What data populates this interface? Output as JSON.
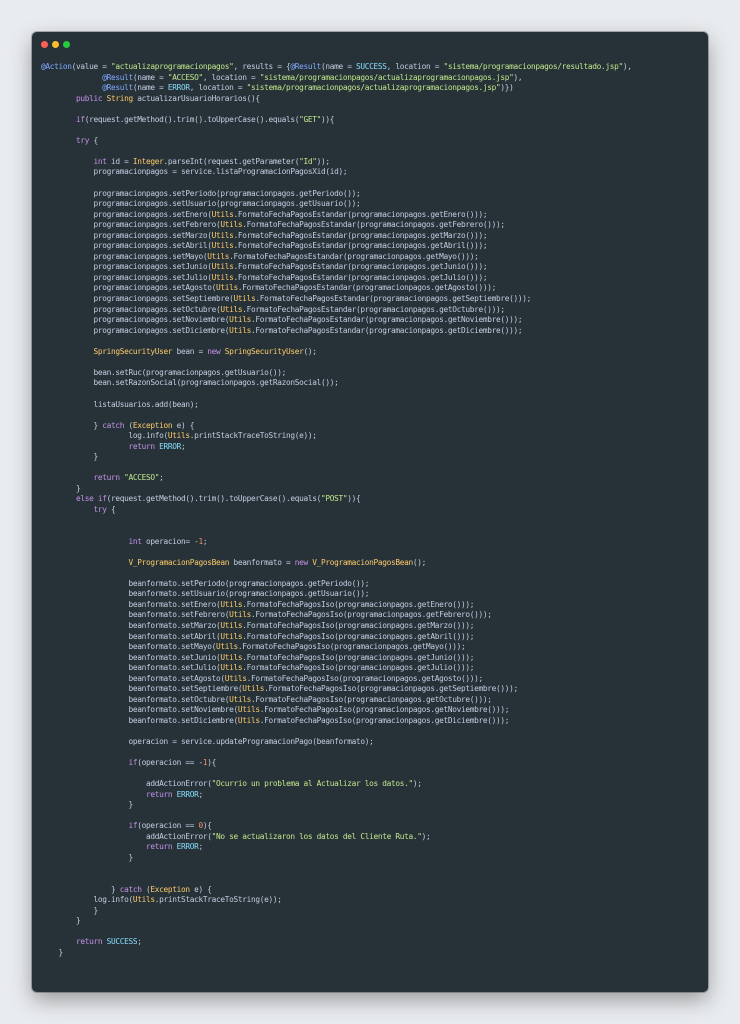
{
  "window": {
    "title_dots": [
      "close",
      "minimize",
      "maximize"
    ]
  },
  "colors": {
    "background": "#e9ecef",
    "editor": "#263238",
    "default": "#c3cee3",
    "keyword": "#c792ea",
    "annotation": "#82aaff",
    "string": "#c3e88d",
    "number": "#f78c6c",
    "type": "#ffcb6b",
    "punct": "#89ddff"
  },
  "code_lines": [
    "@Action(value = \"actualizaprogramacionpagos\", results = {@Result(name = SUCCESS, location = \"sistema/programacionpagos/resultado.jsp\"),",
    "              @Result(name = \"ACCESO\", location = \"sistema/programacionpagos/actualizaprogramacionpagos.jsp\"),",
    "              @Result(name = ERROR, location = \"sistema/programacionpagos/actualizaprogramacionpagos.jsp\")})",
    "        public String actualizarUsuarioHorarios(){",
    "",
    "        if(request.getMethod().trim().toUpperCase().equals(\"GET\")){",
    "",
    "        try {",
    "",
    "            int id = Integer.parseInt(request.getParameter(\"Id\"));",
    "            programacionpagos = service.listaProgramacionPagosXid(id);",
    "",
    "            programacionpagos.setPeriodo(programacionpagos.getPeriodo());",
    "            programacionpagos.setUsuario(programacionpagos.getUsuario());",
    "            programacionpagos.setEnero(Utils.FormatoFechaPagosEstandar(programacionpagos.getEnero()));",
    "            programacionpagos.setFebrero(Utils.FormatoFechaPagosEstandar(programacionpagos.getFebrero()));",
    "            programacionpagos.setMarzo(Utils.FormatoFechaPagosEstandar(programacionpagos.getMarzo()));",
    "            programacionpagos.setAbril(Utils.FormatoFechaPagosEstandar(programacionpagos.getAbril()));",
    "            programacionpagos.setMayo(Utils.FormatoFechaPagosEstandar(programacionpagos.getMayo()));",
    "            programacionpagos.setJunio(Utils.FormatoFechaPagosEstandar(programacionpagos.getJunio()));",
    "            programacionpagos.setJulio(Utils.FormatoFechaPagosEstandar(programacionpagos.getJulio()));",
    "            programacionpagos.setAgosto(Utils.FormatoFechaPagosEstandar(programacionpagos.getAgosto()));",
    "            programacionpagos.setSeptiembre(Utils.FormatoFechaPagosEstandar(programacionpagos.getSeptiembre()));",
    "            programacionpagos.setOctubre(Utils.FormatoFechaPagosEstandar(programacionpagos.getOctubre()));",
    "            programacionpagos.setNoviembre(Utils.FormatoFechaPagosEstandar(programacionpagos.getNoviembre()));",
    "            programacionpagos.setDiciembre(Utils.FormatoFechaPagosEstandar(programacionpagos.getDiciembre()));",
    "",
    "            SpringSecurityUser bean = new SpringSecurityUser();",
    "",
    "            bean.setRuc(programacionpagos.getUsuario());",
    "            bean.setRazonSocial(programacionpagos.getRazonSocial());",
    "",
    "            listaUsuarios.add(bean);",
    "",
    "            } catch (Exception e) {",
    "                    log.info(Utils.printStackTraceToString(e));",
    "                    return ERROR;",
    "            }",
    "",
    "            return \"ACCESO\";",
    "        }",
    "        else if(request.getMethod().trim().toUpperCase().equals(\"POST\")){",
    "            try {",
    "",
    "",
    "                    int operacion= -1;",
    "",
    "                    V_ProgramacionPagosBean beanformato = new V_ProgramacionPagosBean();",
    "",
    "                    beanformato.setPeriodo(programacionpagos.getPeriodo());",
    "                    beanformato.setUsuario(programacionpagos.getUsuario());",
    "                    beanformato.setEnero(Utils.FormatoFechaPagosIso(programacionpagos.getEnero()));",
    "                    beanformato.setFebrero(Utils.FormatoFechaPagosIso(programacionpagos.getFebrero()));",
    "                    beanformato.setMarzo(Utils.FormatoFechaPagosIso(programacionpagos.getMarzo()));",
    "                    beanformato.setAbril(Utils.FormatoFechaPagosIso(programacionpagos.getAbril()));",
    "                    beanformato.setMayo(Utils.FormatoFechaPagosIso(programacionpagos.getMayo()));",
    "                    beanformato.setJunio(Utils.FormatoFechaPagosIso(programacionpagos.getJunio()));",
    "                    beanformato.setJulio(Utils.FormatoFechaPagosIso(programacionpagos.getJulio()));",
    "                    beanformato.setAgosto(Utils.FormatoFechaPagosIso(programacionpagos.getAgosto()));",
    "                    beanformato.setSeptiembre(Utils.FormatoFechaPagosIso(programacionpagos.getSeptiembre()));",
    "                    beanformato.setOctubre(Utils.FormatoFechaPagosIso(programacionpagos.getOctubre()));",
    "                    beanformato.setNoviembre(Utils.FormatoFechaPagosIso(programacionpagos.getNoviembre()));",
    "                    beanformato.setDiciembre(Utils.FormatoFechaPagosIso(programacionpagos.getDiciembre()));",
    "",
    "                    operacion = service.updateProgramacionPago(beanformato);",
    "",
    "                    if(operacion == -1){",
    "",
    "                        addActionError(\"Ocurrio un problema al Actualizar los datos.\");",
    "                        return ERROR;",
    "                    }",
    "",
    "                    if(operacion == 0){",
    "                        addActionError(\"No se actualizaron los datos del Cliente Ruta.\");",
    "                        return ERROR;",
    "                    }",
    "",
    "",
    "                } catch (Exception e) {",
    "            log.info(Utils.printStackTraceToString(e));",
    "            }",
    "        }",
    "",
    "        return SUCCESS;",
    "    }"
  ]
}
